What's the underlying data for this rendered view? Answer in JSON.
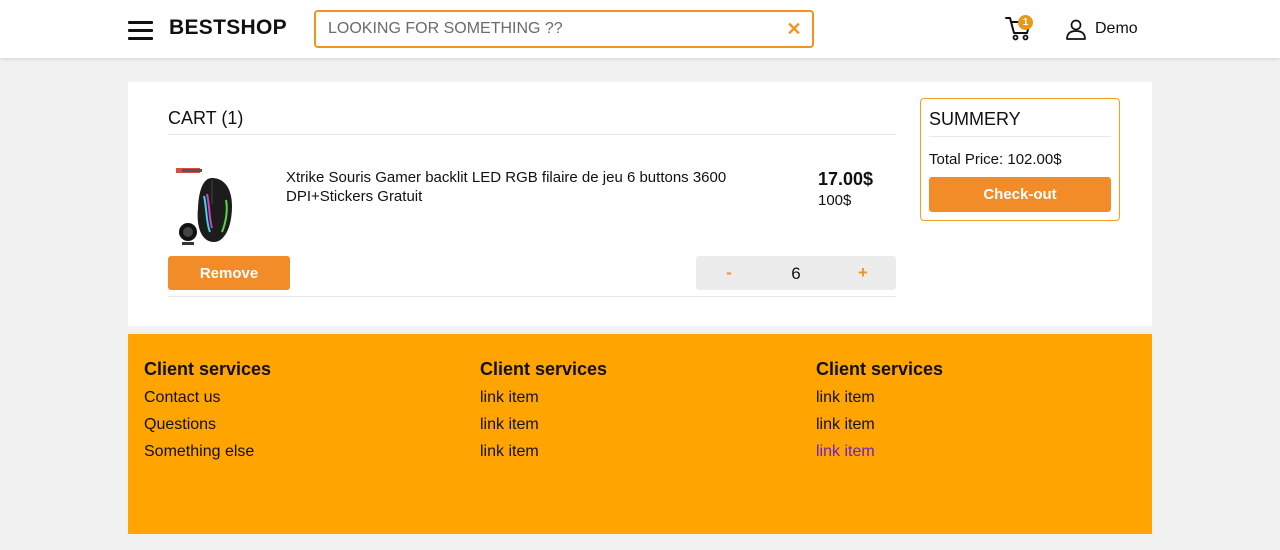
{
  "header": {
    "brand": "BESTSHOP",
    "search_placeholder": "LOOKING FOR SOMETHING ??",
    "clear_label": "✕",
    "cart_count": "1",
    "user_name": "Demo"
  },
  "cart": {
    "title": "CART (1)",
    "item": {
      "name": "Xtrike Souris Gamer backlit LED RGB filaire de jeu 6 buttons 3600 DPI+Stickers Gratuit",
      "price_new": "17.00$",
      "price_old": "100$",
      "quantity": "6"
    },
    "remove_label": "Remove",
    "qty_minus_label": "-",
    "qty_plus_label": "+"
  },
  "summary": {
    "title": "SUMMERY",
    "total_price": "Total Price: 102.00$",
    "checkout_label": "Check-out"
  },
  "footer": {
    "columns": [
      {
        "heading": "Client services",
        "links": [
          "Contact us",
          "Questions",
          "Something else"
        ]
      },
      {
        "heading": "Client services",
        "links": [
          "link item",
          "link item",
          "link item"
        ]
      },
      {
        "heading": "Client services",
        "links": [
          "link item",
          "link item",
          "link item"
        ]
      }
    ]
  },
  "colors": {
    "accent": "#f28c28",
    "footer_bg": "#ffa400",
    "visited_link": "#6a1fd0"
  }
}
